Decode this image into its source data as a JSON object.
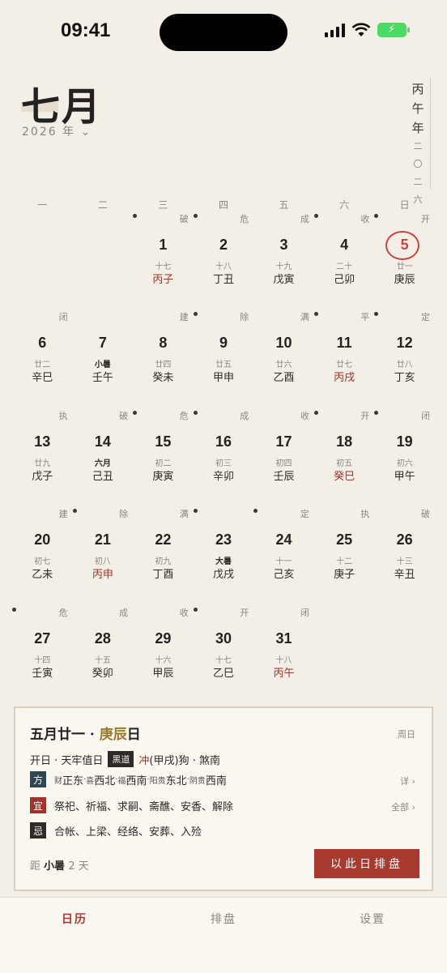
{
  "status": {
    "time": "09:41"
  },
  "header": {
    "month": "七月",
    "year_label": "2026 年 ⌄",
    "vertical_year": [
      "丙",
      "午",
      "年"
    ],
    "vertical_num": [
      "二",
      "〇",
      "二",
      "六"
    ]
  },
  "weekdays": [
    "一",
    "二",
    "三",
    "四",
    "五",
    "六",
    "日"
  ],
  "today": 5,
  "days": [
    {
      "d": "1",
      "lunar": "十七",
      "gz": "丙子",
      "officer": "破",
      "dot": true,
      "red": true
    },
    {
      "d": "2",
      "lunar": "十八",
      "gz": "丁丑",
      "officer": "危",
      "dot": true,
      "red": false
    },
    {
      "d": "3",
      "lunar": "十九",
      "gz": "戊寅",
      "officer": "成",
      "dot": false,
      "red": false
    },
    {
      "d": "4",
      "lunar": "二十",
      "gz": "己卯",
      "officer": "收",
      "dot": true,
      "red": false
    },
    {
      "d": "5",
      "lunar": "廿一",
      "gz": "庚辰",
      "officer": "开",
      "dot": true,
      "red": false
    },
    {
      "d": "6",
      "lunar": "廿二",
      "gz": "辛巳",
      "officer": "闭",
      "dot": false,
      "red": false
    },
    {
      "d": "7",
      "lunar": "小暑",
      "gz": "壬午",
      "officer": "",
      "dot": false,
      "red": false,
      "term": true
    },
    {
      "d": "8",
      "lunar": "廿四",
      "gz": "癸未",
      "officer": "建",
      "dot": false,
      "red": false
    },
    {
      "d": "9",
      "lunar": "廿五",
      "gz": "甲申",
      "officer": "除",
      "dot": true,
      "red": false
    },
    {
      "d": "10",
      "lunar": "廿六",
      "gz": "乙酉",
      "officer": "满",
      "dot": false,
      "red": false
    },
    {
      "d": "11",
      "lunar": "廿七",
      "gz": "丙戌",
      "officer": "平",
      "dot": true,
      "red": true
    },
    {
      "d": "12",
      "lunar": "廿八",
      "gz": "丁亥",
      "officer": "定",
      "dot": true,
      "red": false
    },
    {
      "d": "13",
      "lunar": "廿九",
      "gz": "戊子",
      "officer": "执",
      "dot": false,
      "red": false
    },
    {
      "d": "14",
      "lunar": "六月",
      "gz": "己丑",
      "officer": "破",
      "dot": false,
      "red": false,
      "term": true
    },
    {
      "d": "15",
      "lunar": "初二",
      "gz": "庚寅",
      "officer": "危",
      "dot": true,
      "red": false
    },
    {
      "d": "16",
      "lunar": "初三",
      "gz": "辛卯",
      "officer": "成",
      "dot": true,
      "red": false
    },
    {
      "d": "17",
      "lunar": "初四",
      "gz": "壬辰",
      "officer": "收",
      "dot": false,
      "red": false
    },
    {
      "d": "18",
      "lunar": "初五",
      "gz": "癸巳",
      "officer": "开",
      "dot": true,
      "red": true
    },
    {
      "d": "19",
      "lunar": "初六",
      "gz": "甲午",
      "officer": "闭",
      "dot": true,
      "red": false
    },
    {
      "d": "20",
      "lunar": "初七",
      "gz": "乙未",
      "officer": "建",
      "dot": false,
      "red": false
    },
    {
      "d": "21",
      "lunar": "初八",
      "gz": "丙申",
      "officer": "除",
      "dot": true,
      "red": true
    },
    {
      "d": "22",
      "lunar": "初九",
      "gz": "丁酉",
      "officer": "满",
      "dot": false,
      "red": false
    },
    {
      "d": "23",
      "lunar": "大暑",
      "gz": "戊戌",
      "officer": "",
      "dot": true,
      "red": false,
      "term": true
    },
    {
      "d": "24",
      "lunar": "十一",
      "gz": "己亥",
      "officer": "定",
      "dot": true,
      "red": false
    },
    {
      "d": "25",
      "lunar": "十二",
      "gz": "庚子",
      "officer": "执",
      "dot": false,
      "red": false
    },
    {
      "d": "26",
      "lunar": "十三",
      "gz": "辛丑",
      "officer": "破",
      "dot": false,
      "red": false
    },
    {
      "d": "27",
      "lunar": "十四",
      "gz": "壬寅",
      "officer": "危",
      "dot": true,
      "red": false
    },
    {
      "d": "28",
      "lunar": "十五",
      "gz": "癸卯",
      "officer": "成",
      "dot": false,
      "red": false
    },
    {
      "d": "29",
      "lunar": "十六",
      "gz": "甲辰",
      "officer": "收",
      "dot": false,
      "red": false
    },
    {
      "d": "30",
      "lunar": "十七",
      "gz": "乙巳",
      "officer": "开",
      "dot": true,
      "red": false
    },
    {
      "d": "31",
      "lunar": "十八",
      "gz": "丙午",
      "officer": "闭",
      "dot": false,
      "red": true
    }
  ],
  "card": {
    "title_prefix": "五月廿一 · ",
    "title_gz": "庚辰",
    "title_suffix": "日",
    "weekday": "周日",
    "line1_text": "开日 · 天牢值日",
    "line1_badge": "黑道",
    "line1_chong_red": "冲",
    "line1_rest": "(甲戌)狗 · 煞南",
    "dir_icon": "方",
    "dir": [
      {
        "k": "财",
        "v": "正东"
      },
      {
        "k": "喜",
        "v": "西北"
      },
      {
        "k": "福",
        "v": "西南"
      },
      {
        "k": "阳贵",
        "v": "东北"
      },
      {
        "k": "阴贵",
        "v": "西南"
      }
    ],
    "dir_more": "详 ›",
    "yi_icon": "宜",
    "yi": "祭祀、祈福、求嗣、斋醮、安香、解除",
    "yi_more": "全部 ›",
    "ji_icon": "忌",
    "ji": "合帐、上梁、经络、安葬、入殓",
    "countdown_pre": "距",
    "countdown_term": "小暑",
    "countdown_post": "2 天",
    "cta": "以此日排盘"
  },
  "tabs": [
    "日历",
    "排盘",
    "设置"
  ],
  "active_tab": 0
}
